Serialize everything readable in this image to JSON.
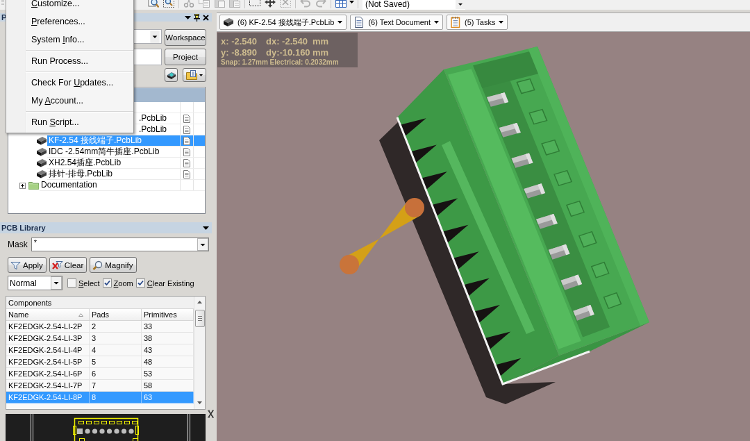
{
  "toolbar": {
    "buttons": [
      {
        "kind": "zoom-fit",
        "disabled": false
      },
      {
        "kind": "zoom-area",
        "disabled": false
      },
      {
        "kind": "separator"
      },
      {
        "kind": "cut",
        "disabled": true
      },
      {
        "kind": "copy",
        "disabled": true
      },
      {
        "kind": "paste",
        "disabled": true
      },
      {
        "kind": "paste-special",
        "disabled": true
      },
      {
        "kind": "separator"
      },
      {
        "kind": "select-area",
        "disabled": false
      },
      {
        "kind": "move",
        "disabled": false
      },
      {
        "kind": "cross-select",
        "disabled": true
      },
      {
        "kind": "separator"
      },
      {
        "kind": "undo",
        "disabled": true
      },
      {
        "kind": "redo",
        "disabled": true
      },
      {
        "kind": "separator"
      },
      {
        "kind": "grid",
        "disabled": false
      },
      {
        "kind": "caret",
        "disabled": false
      },
      {
        "kind": "separator"
      }
    ],
    "document_combo": {
      "value": "(Not Saved)"
    }
  },
  "menu": {
    "items": [
      {
        "kind": "item",
        "key": "C",
        "after": "ustomize..."
      },
      {
        "kind": "item",
        "key": "P",
        "after": "references..."
      },
      {
        "kind": "item",
        "before": "System ",
        "key": "I",
        "after": "nfo..."
      },
      {
        "kind": "separator"
      },
      {
        "kind": "item",
        "before": "Run Process..."
      },
      {
        "kind": "separator"
      },
      {
        "kind": "item",
        "before": "Check For ",
        "key": "U",
        "after": "pdates..."
      },
      {
        "kind": "item",
        "before": "My ",
        "key": "A",
        "after": "ccount..."
      },
      {
        "kind": "separator"
      },
      {
        "kind": "item",
        "before": "Run ",
        "key": "S",
        "after": "cript..."
      }
    ]
  },
  "projects_panel": {
    "title": "P",
    "workspace_button": "Workspace",
    "project_button": "Project",
    "tree": {
      "items": [
        {
          "kind": "folder",
          "children": [
            {
              "kind": "clipped",
              "label": ".PcbLib",
              "selected": false
            },
            {
              "kind": "clipped",
              "label": ".PcbLib",
              "selected": false
            },
            {
              "kind": "library",
              "label": "KF-2.54 接线端子.PcbLib",
              "selected": true
            },
            {
              "kind": "library",
              "label": "IDC -2.54mm简牛插座.PcbLib",
              "selected": false
            },
            {
              "kind": "library",
              "label": "XH2.54插座.PcbLib",
              "selected": false
            },
            {
              "kind": "library",
              "label": "排针-排母.PcbLib",
              "selected": false
            }
          ]
        },
        {
          "kind": "folder",
          "label": "Documentation",
          "expanded": false,
          "selected": false
        }
      ]
    }
  },
  "pcb_library": {
    "title": "PCB Library",
    "mask": {
      "label": "Mask",
      "value": "*"
    },
    "buttons": [
      {
        "kind": "apply",
        "label": "Apply"
      },
      {
        "kind": "clear",
        "label": "Clear"
      },
      {
        "kind": "magnify",
        "label": "Magnify"
      }
    ],
    "mode": {
      "value": "Normal"
    },
    "options": [
      {
        "key": "S",
        "after": "elect",
        "checked": false
      },
      {
        "key": "Z",
        "after": "oom",
        "checked": true
      },
      {
        "key": "C",
        "after": "lear Existing",
        "checked": true
      }
    ],
    "components": {
      "title": "Components",
      "columns": [
        {
          "label": "Name",
          "sorted": true
        },
        {
          "label": "Pads",
          "sorted": false
        },
        {
          "label": "Primitives",
          "sorted": false
        }
      ],
      "rows": [
        {
          "cells": [
            "KF2EDGK-2.54-LI-2P",
            "2",
            "33"
          ],
          "selected": false
        },
        {
          "cells": [
            "KF2EDGK-2.54-LI-3P",
            "3",
            "38"
          ],
          "selected": false
        },
        {
          "cells": [
            "KF2EDGK-2.54-LI-4P",
            "4",
            "43"
          ],
          "selected": false
        },
        {
          "cells": [
            "KF2EDGK-2.54-LI-5P",
            "5",
            "48"
          ],
          "selected": false
        },
        {
          "cells": [
            "KF2EDGK-2.54-LI-6P",
            "6",
            "53"
          ],
          "selected": false
        },
        {
          "cells": [
            "KF2EDGK-2.54-LI-7P",
            "7",
            "58"
          ],
          "selected": false
        },
        {
          "cells": [
            "KF2EDGK-2.54-LI-8P",
            "8",
            "63"
          ],
          "selected": true
        }
      ]
    }
  },
  "document_tabs": [
    {
      "kind": "library",
      "label": "(6) KF-2.54 接线端子.PcbLib"
    },
    {
      "kind": "text",
      "label": "(6) Text Document"
    },
    {
      "kind": "tasks",
      "label": "(5) Tasks"
    }
  ],
  "viewport": {
    "coordinates": {
      "rows": [
        [
          "x: -2.540",
          "dx: -2.540",
          "mm"
        ],
        [
          "y: -8.890",
          "dy:-10.160",
          "mm"
        ]
      ],
      "snap": "Snap: 1.27mm Electrical: 0.2032mm"
    }
  }
}
